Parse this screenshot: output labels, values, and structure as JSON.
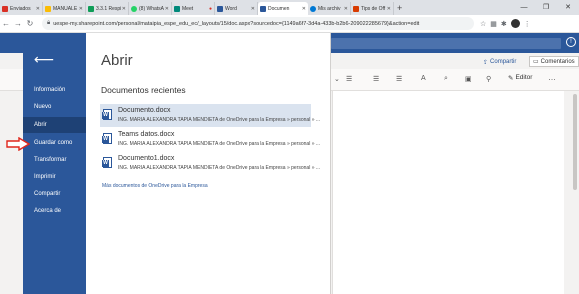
{
  "browser": {
    "tabs": [
      {
        "label": "Enviados",
        "color": "#d93025"
      },
      {
        "label": "MANUALE",
        "color": "#fbbc04"
      },
      {
        "label": "3.3.1 Respi",
        "color": "#0f9d58"
      },
      {
        "label": "(8) WhatsA",
        "color": "#25d366"
      },
      {
        "label": "Meet",
        "color": "#00897b"
      },
      {
        "label": "Word",
        "color": "#2b579a"
      },
      {
        "label": "Documen",
        "color": "#2b579a",
        "active": true
      },
      {
        "label": "Mis archiv",
        "color": "#0078d4"
      },
      {
        "label": "Tips de Off",
        "color": "#d83b01"
      }
    ],
    "url": "uespe-my.sharepoint.com/personal/mataipia_espe_edu_ec/_layouts/15/doc.aspx?sourcedoc={1149a6f7-3d4a-433b-b2b6-209022285679}&action=edit"
  },
  "ribbon": {
    "share_label": "Compartir",
    "comments_label": "Comentarios",
    "editor_label": "Editor"
  },
  "sidebar": {
    "items": [
      "Información",
      "Nuevo",
      "Abrir",
      "Guardar como",
      "Transformar",
      "Imprimir",
      "Compartir",
      "Acerca de"
    ],
    "selected": "Abrir"
  },
  "backstage": {
    "title": "Abrir",
    "section_title": "Documentos recientes",
    "documents": [
      {
        "name": "Documento.docx",
        "path": "ING. MARIA ALEXANDRA TAPIA MENDIETA de OneDrive para la Empresa » personal » ..."
      },
      {
        "name": "Teams datos.docx",
        "path": "ING. MARIA ALEXANDRA TAPIA MENDIETA de OneDrive para la Empresa » personal » ..."
      },
      {
        "name": "Documento1.docx",
        "path": "ING. MARIA ALEXANDRA TAPIA MENDIETA de OneDrive para la Empresa » personal » ..."
      }
    ],
    "more_link": "Más documentos de OneDrive para la Empresa"
  },
  "colors": {
    "word_blue": "#2b579a",
    "selected_blue": "#1e4175",
    "highlight": "#dae3ef",
    "annotation_red": "#e0261b"
  }
}
